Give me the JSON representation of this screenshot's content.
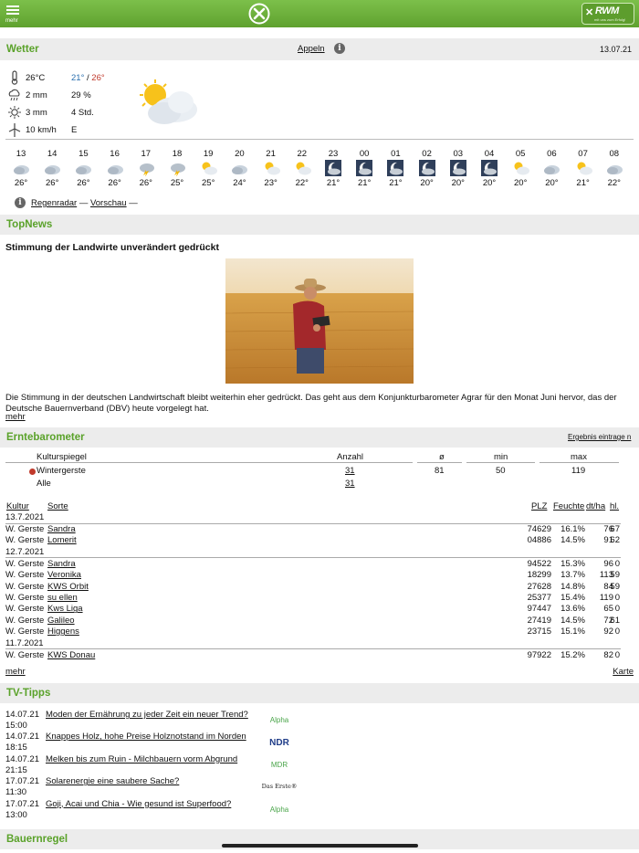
{
  "topbar": {
    "menu_label": "mehr",
    "logo_text": "RWM",
    "logo_sub": "mit uns zum Erfolg!"
  },
  "weather": {
    "section_title": "Wetter",
    "location": "Appeln",
    "date": "13.07.21",
    "temp_current": "26°C",
    "temp_min": "21°",
    "temp_sep": "/",
    "temp_max": "26°",
    "precip": "2 mm",
    "precip_prob": "29 %",
    "sun_mm": "3 mm",
    "sun_hours": "4 Std.",
    "wind": "10 km/h",
    "wind_dir": "E",
    "hours": [
      {
        "h": "13",
        "t": "26°",
        "icon": "cloud"
      },
      {
        "h": "14",
        "t": "26°",
        "icon": "cloud"
      },
      {
        "h": "15",
        "t": "26°",
        "icon": "cloud"
      },
      {
        "h": "16",
        "t": "26°",
        "icon": "cloud"
      },
      {
        "h": "17",
        "t": "26°",
        "icon": "thunder"
      },
      {
        "h": "18",
        "t": "25°",
        "icon": "thunder"
      },
      {
        "h": "19",
        "t": "25°",
        "icon": "sun-cloud"
      },
      {
        "h": "20",
        "t": "24°",
        "icon": "cloud"
      },
      {
        "h": "21",
        "t": "23°",
        "icon": "sun-cloud"
      },
      {
        "h": "22",
        "t": "22°",
        "icon": "sun-cloud"
      },
      {
        "h": "23",
        "t": "21°",
        "icon": "night"
      },
      {
        "h": "00",
        "t": "21°",
        "icon": "night"
      },
      {
        "h": "01",
        "t": "21°",
        "icon": "night"
      },
      {
        "h": "02",
        "t": "20°",
        "icon": "night"
      },
      {
        "h": "03",
        "t": "20°",
        "icon": "night"
      },
      {
        "h": "04",
        "t": "20°",
        "icon": "night"
      },
      {
        "h": "05",
        "t": "20°",
        "icon": "sun-cloud"
      },
      {
        "h": "06",
        "t": "20°",
        "icon": "cloud"
      },
      {
        "h": "07",
        "t": "21°",
        "icon": "sun-cloud"
      },
      {
        "h": "08",
        "t": "22°",
        "icon": "cloud"
      }
    ],
    "link_radar": "Regenradar",
    "link_dash1": "—",
    "link_forecast": "Vorschau",
    "link_dash2": "—"
  },
  "topnews": {
    "section_title": "TopNews",
    "headline": "Stimmung der Landwirte unverändert gedrückt",
    "body": "Die Stimmung in der deutschen Landwirtschaft bleibt weiterhin eher gedrückt. Das geht aus dem Konjunkturbarometer Agrar für den Monat Juni hervor, das der Deutsche Bauernverband (DBV) heute vorgelegt hat.",
    "more": "mehr"
  },
  "erntebarometer": {
    "section_title": "Erntebarometer",
    "result_link": "Ergebnis eintrage n",
    "summary_headers": [
      "Kulturspiegel",
      "Anzahl",
      "ø",
      "min",
      "max"
    ],
    "summary_rows": [
      {
        "name": "Wintergerste",
        "count": "31",
        "avg": "81",
        "min": "50",
        "max": "119"
      },
      {
        "name": "Alle",
        "count": "31",
        "avg": "",
        "min": "",
        "max": ""
      }
    ],
    "detail_headers": {
      "kultur": "Kultur",
      "sorte": "Sorte",
      "plz": "PLZ",
      "feuchte": "Feuchte",
      "dtha": "dt/ha",
      "hl": "hl."
    },
    "groups": [
      {
        "date": "13.7.2021",
        "rows": [
          {
            "kultur": "W. Gerste",
            "sorte": "Sandra",
            "plz": "74629",
            "feuchte": "16.1%",
            "dtha": "76",
            "hl": "67"
          },
          {
            "kultur": "W. Gerste",
            "sorte": "Lomerit",
            "plz": "04886",
            "feuchte": "14.5%",
            "dtha": "91",
            "hl": "62"
          }
        ]
      },
      {
        "date": "12.7.2021",
        "rows": [
          {
            "kultur": "W. Gerste",
            "sorte": "Sandra",
            "plz": "94522",
            "feuchte": "15.3%",
            "dtha": "96",
            "hl": "0"
          },
          {
            "kultur": "W. Gerste",
            "sorte": "Veronika",
            "plz": "18299",
            "feuchte": "13.7%",
            "dtha": "113",
            "hl": "59"
          },
          {
            "kultur": "W. Gerste",
            "sorte": "KWS Orbit",
            "plz": "27628",
            "feuchte": "14.8%",
            "dtha": "84",
            "hl": "59"
          },
          {
            "kultur": "W. Gerste",
            "sorte": "su ellen",
            "plz": "25377",
            "feuchte": "15.4%",
            "dtha": "119",
            "hl": "0"
          },
          {
            "kultur": "W. Gerste",
            "sorte": "Kws Liga",
            "plz": "97447",
            "feuchte": "13.6%",
            "dtha": "65",
            "hl": "0"
          },
          {
            "kultur": "W. Gerste",
            "sorte": "Galileo",
            "plz": "27419",
            "feuchte": "14.5%",
            "dtha": "72",
            "hl": "61"
          },
          {
            "kultur": "W. Gerste",
            "sorte": "Higgens",
            "plz": "23715",
            "feuchte": "15.1%",
            "dtha": "92",
            "hl": "0"
          }
        ]
      },
      {
        "date": "11.7.2021",
        "rows": [
          {
            "kultur": "W. Gerste",
            "sorte": "KWS Donau",
            "plz": "97922",
            "feuchte": "15.2%",
            "dtha": "82",
            "hl": "0"
          }
        ]
      }
    ],
    "more": "mehr",
    "map": "Karte"
  },
  "tv": {
    "section_title": "TV-Tipps",
    "items": [
      {
        "date": "14.07.21",
        "time": "15:00",
        "title": "Moden der Ernährung zu jeder Zeit ein neuer Trend?",
        "channel": "Alpha"
      },
      {
        "date": "14.07.21",
        "time": "18:15",
        "title": "Knappes Holz, hohe Preise Holznotstand im Norden",
        "channel": "NDR"
      },
      {
        "date": "14.07.21",
        "time": "21:15",
        "title": "Melken bis zum Ruin - Milchbauern vorm Abgrund",
        "channel": "MDR"
      },
      {
        "date": "17.07.21",
        "time": "11:30",
        "title": "Solarenergie  eine saubere Sache?",
        "channel": "Das Erste®"
      },
      {
        "date": "17.07.21",
        "time": "13:00",
        "title": "Goji, Acai und Chia - Wie gesund ist Superfood?",
        "channel": "Alpha"
      }
    ]
  },
  "bauernregel": {
    "section_title": "Bauernregel"
  }
}
